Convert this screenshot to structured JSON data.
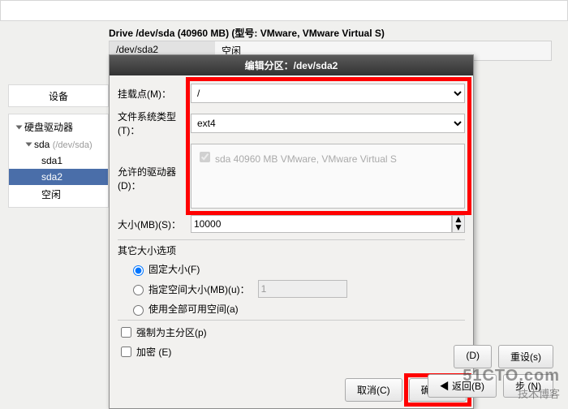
{
  "drive_info": "Drive /dev/sda (40960 MB) (型号: VMware, VMware Virtual S)",
  "drive_row": {
    "dev": "/dev/sda2",
    "free": "空闲"
  },
  "side_header": "设备",
  "tree": {
    "root": "硬盘驱动器",
    "sda": "sda",
    "sda_sub": "(/dev/sda)",
    "sda1": "sda1",
    "sda2": "sda2",
    "free": "空闲"
  },
  "dialog": {
    "title": "编辑分区：/dev/sda2",
    "mount_label": "挂载点(M)：",
    "mount_value": "/",
    "fstype_label": "文件系统类型(T)：",
    "fstype_value": "ext4",
    "driver_label": "允许的驱动器(D)：",
    "driver_item": "sda     40960 MB     VMware, VMware Virtual S",
    "size_label": "大小(MB)(S)：",
    "size_value": "10000",
    "other_title": "其它大小选项",
    "opt_fixed": "固定大小(F)",
    "opt_range": "指定空间大小(MB)(u)：",
    "opt_range_val": "1",
    "opt_all": "使用全部可用空间(a)",
    "chk_primary": "强制为主分区(p)",
    "chk_encrypt": "加密 (E)",
    "btn_cancel": "取消(C)",
    "btn_ok": "确定(O)"
  },
  "outer_btns": {
    "d": "(D)",
    "reset": "重设(s)",
    "back": "返回(B)",
    "next": "步 (N)"
  },
  "watermark": {
    "l1": "51CTO.com",
    "l2": "技术博客"
  }
}
